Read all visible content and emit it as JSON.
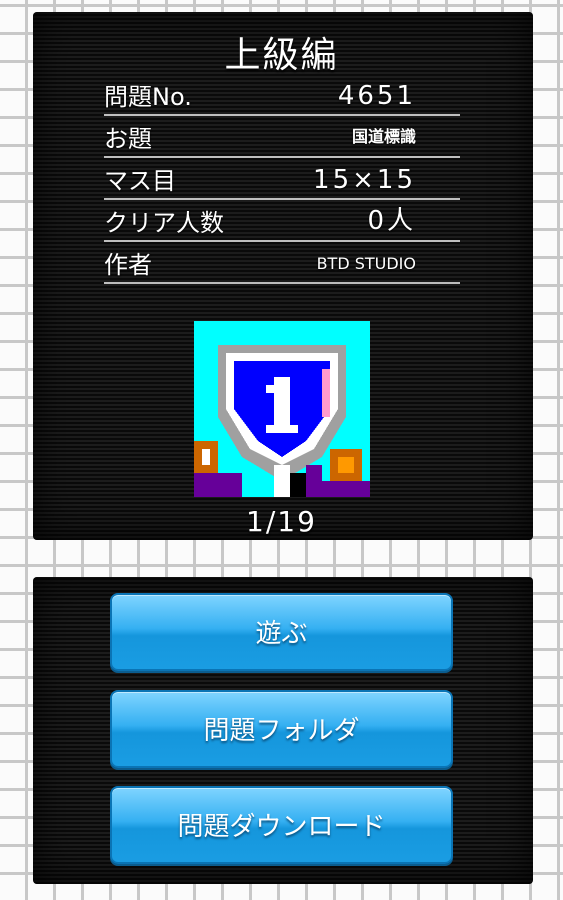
{
  "header": {
    "title": "上級編"
  },
  "info": [
    {
      "label": "問題No.",
      "value": "4651"
    },
    {
      "label": "お題",
      "value": "国道標識"
    },
    {
      "label": "マス目",
      "value": "15×15"
    },
    {
      "label": "クリア人数",
      "value": "0人"
    },
    {
      "label": "作者",
      "value": "BTD STUDIO"
    }
  ],
  "preview": {
    "page": "1/19"
  },
  "buttons": {
    "play": "遊ぶ",
    "folder": "問題フォルダ",
    "download": "問題ダウンロード"
  },
  "colors": {
    "button_blue": "#1a9de3",
    "panel_bg": "#111111",
    "thumb_cyan": "#00ffff",
    "shield_blue": "#0000ff"
  }
}
